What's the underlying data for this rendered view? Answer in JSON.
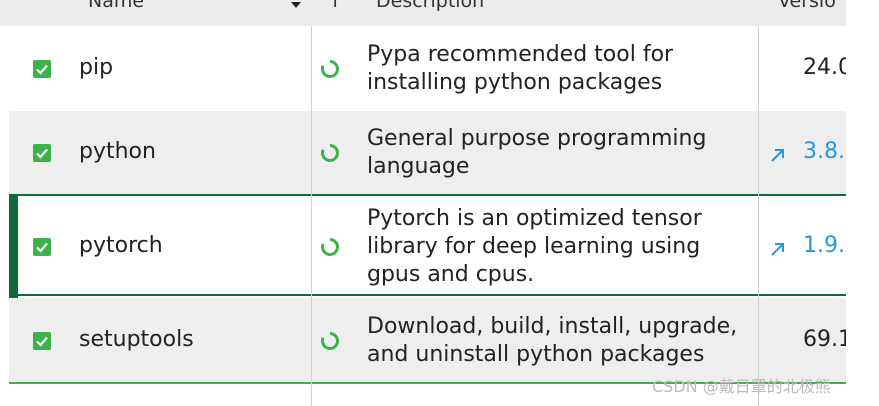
{
  "header": {
    "name_label": "Name",
    "t_label": "T",
    "description_label": "Description",
    "version_label": "Versio"
  },
  "packages": [
    {
      "name": "pip",
      "description": "Pypa recommended tool for installing python packages",
      "version": "24.0"
    },
    {
      "name": "python",
      "description": "General purpose programming language",
      "version": "3.8."
    },
    {
      "name": "pytorch",
      "description": "Pytorch is an optimized tensor library for deep learning using gpus and cpus.",
      "version": "1.9."
    },
    {
      "name": "setuptools",
      "description": "Download, build, install, upgrade, and uninstall python packages",
      "version": "69.1"
    }
  ],
  "watermark": "CSDN @戴日罩的北极熊",
  "colors": {
    "check": "#3bb34a",
    "selected_bar": "#0f6b3a",
    "link": "#1e9be0",
    "status_ring": "#3bb34a"
  },
  "icons": {
    "check": "check-icon",
    "status": "installed-status-icon",
    "upgrade": "upgrade-arrow-icon",
    "sort": "sort-descending-icon"
  }
}
